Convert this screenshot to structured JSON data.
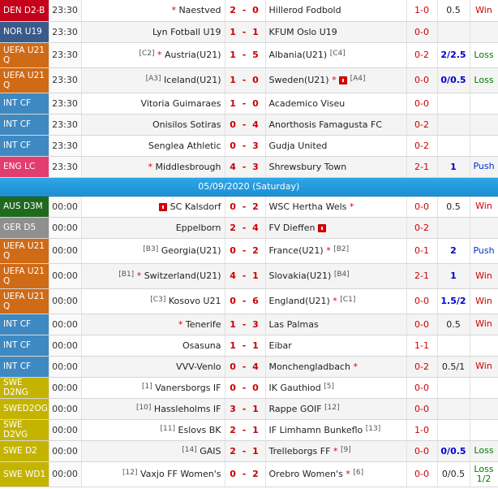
{
  "colors": {
    "DEN D2-B": "#c5001a",
    "NOR U19": "#3a5a8a",
    "UEFA U21 Q": "#cf6a16",
    "INT CF": "#3f89c2",
    "ENG LC": "#e23d72",
    "AUS D3M": "#1f6a1f",
    "GER D5": "#8f8f8f",
    "SWE D2NG": "#c4b400",
    "SWED2OG": "#c4b400",
    "SWE D2VG": "#c4b400",
    "SWE D2": "#c4b400",
    "SWE WD1": "#c4b400"
  },
  "date_header": "05/09/2020 (Saturday)",
  "matches_before": [
    {
      "league": "DEN D2-B",
      "time": "23:30",
      "home_rank": "",
      "home_star": true,
      "home_card": false,
      "home": "Naestved",
      "score": "2 - 0",
      "away": "Hillerod Fodbold",
      "away_star": false,
      "away_card": false,
      "away_rank": "",
      "ht": "1-0",
      "hc": "0.5",
      "hc_blue": false,
      "result": "Win",
      "result_type": "win",
      "size": "r1"
    },
    {
      "league": "NOR U19",
      "time": "23:30",
      "home_rank": "",
      "home_star": false,
      "home_card": false,
      "home": "Lyn Fotball U19",
      "score": "1 - 1",
      "away": "KFUM Oslo U19",
      "away_star": false,
      "away_card": false,
      "away_rank": "",
      "ht": "0-0",
      "hc": "",
      "hc_blue": false,
      "result": "",
      "result_type": "",
      "size": "r1"
    },
    {
      "league": "UEFA U21 Q",
      "time": "23:30",
      "home_rank": "[C2]",
      "home_star": true,
      "home_card": false,
      "home": "Austria(U21)",
      "score": "1 - 5",
      "away": "Albania(U21)",
      "away_star": false,
      "away_card": false,
      "away_rank": "[C4]",
      "ht": "0-2",
      "hc": "2/2.5",
      "hc_blue": true,
      "result": "Loss",
      "result_type": "loss",
      "size": "r2"
    },
    {
      "league": "UEFA U21 Q",
      "time": "23:30",
      "home_rank": "[A3]",
      "home_star": false,
      "home_card": false,
      "home": "Iceland(U21)",
      "score": "1 - 0",
      "away": "Sweden(U21)",
      "away_star": true,
      "away_card": true,
      "away_rank": "[A4]",
      "ht": "0-0",
      "hc": "0/0.5",
      "hc_blue": true,
      "result": "Loss",
      "result_type": "loss",
      "size": "r2"
    },
    {
      "league": "INT CF",
      "time": "23:30",
      "home_rank": "",
      "home_star": false,
      "home_card": false,
      "home": "Vitoria Guimaraes",
      "score": "1 - 0",
      "away": "Academico Viseu",
      "away_star": false,
      "away_card": false,
      "away_rank": "",
      "ht": "0-0",
      "hc": "",
      "hc_blue": false,
      "result": "",
      "result_type": "",
      "size": "r1"
    },
    {
      "league": "INT CF",
      "time": "23:30",
      "home_rank": "",
      "home_star": false,
      "home_card": false,
      "home": "Onisilos Sotiras",
      "score": "0 - 4",
      "away": "Anorthosis Famagusta FC",
      "away_star": false,
      "away_card": false,
      "away_rank": "",
      "ht": "0-2",
      "hc": "",
      "hc_blue": false,
      "result": "",
      "result_type": "",
      "size": "r1"
    },
    {
      "league": "INT CF",
      "time": "23:30",
      "home_rank": "",
      "home_star": false,
      "home_card": false,
      "home": "Senglea Athletic",
      "score": "0 - 3",
      "away": "Gudja United",
      "away_star": false,
      "away_card": false,
      "away_rank": "",
      "ht": "0-2",
      "hc": "",
      "hc_blue": false,
      "result": "",
      "result_type": "",
      "size": "r1"
    },
    {
      "league": "ENG LC",
      "time": "23:30",
      "home_rank": "",
      "home_star": true,
      "home_card": false,
      "home": "Middlesbrough",
      "score": "4 - 3",
      "away": "Shrewsbury Town",
      "away_star": false,
      "away_card": false,
      "away_rank": "",
      "ht": "2-1",
      "hc": "1",
      "hc_blue": true,
      "result": "Push",
      "result_type": "push",
      "size": "r1"
    }
  ],
  "matches_after": [
    {
      "league": "AUS D3M",
      "time": "00:00",
      "home_rank": "",
      "home_star": false,
      "home_card": true,
      "home": "SC Kalsdorf",
      "score": "0 - 2",
      "away": "WSC Hertha Wels",
      "away_star": true,
      "away_card": false,
      "away_rank": "",
      "ht": "0-0",
      "hc": "0.5",
      "hc_blue": false,
      "result": "Win",
      "result_type": "win",
      "size": "r1"
    },
    {
      "league": "GER D5",
      "time": "00:00",
      "home_rank": "",
      "home_star": false,
      "home_card": false,
      "home": "Eppelborn",
      "score": "2 - 4",
      "away": "FV Dieffen",
      "away_star": false,
      "away_card": true,
      "away_rank": "",
      "ht": "0-2",
      "hc": "",
      "hc_blue": false,
      "result": "",
      "result_type": "",
      "size": "r1"
    },
    {
      "league": "UEFA U21 Q",
      "time": "00:00",
      "home_rank": "[B3]",
      "home_star": false,
      "home_card": false,
      "home": "Georgia(U21)",
      "score": "0 - 2",
      "away": "France(U21)",
      "away_star": true,
      "away_card": false,
      "away_rank": "[B2]",
      "ht": "0-1",
      "hc": "2",
      "hc_blue": true,
      "result": "Push",
      "result_type": "push",
      "size": "r2"
    },
    {
      "league": "UEFA U21 Q",
      "time": "00:00",
      "home_rank": "[B1]",
      "home_star": true,
      "home_card": false,
      "home": "Switzerland(U21)",
      "score": "4 - 1",
      "away": "Slovakia(U21)",
      "away_star": false,
      "away_card": false,
      "away_rank": "[B4]",
      "ht": "2-1",
      "hc": "1",
      "hc_blue": true,
      "result": "Win",
      "result_type": "win",
      "size": "r2"
    },
    {
      "league": "UEFA U21 Q",
      "time": "00:00",
      "home_rank": "[C3]",
      "home_star": false,
      "home_card": false,
      "home": "Kosovo U21",
      "score": "0 - 6",
      "away": "England(U21)",
      "away_star": true,
      "away_card": false,
      "away_rank": "[C1]",
      "ht": "0-0",
      "hc": "1.5/2",
      "hc_blue": true,
      "result": "Win",
      "result_type": "win",
      "size": "r2"
    },
    {
      "league": "INT CF",
      "time": "00:00",
      "home_rank": "",
      "home_star": true,
      "home_card": false,
      "home": "Tenerife",
      "score": "1 - 3",
      "away": "Las Palmas",
      "away_star": false,
      "away_card": false,
      "away_rank": "",
      "ht": "0-0",
      "hc": "0.5",
      "hc_blue": false,
      "result": "Win",
      "result_type": "win",
      "size": "r1"
    },
    {
      "league": "INT CF",
      "time": "00:00",
      "home_rank": "",
      "home_star": false,
      "home_card": false,
      "home": "Osasuna",
      "score": "1 - 1",
      "away": "Eibar",
      "away_star": false,
      "away_card": false,
      "away_rank": "",
      "ht": "1-1",
      "hc": "",
      "hc_blue": false,
      "result": "",
      "result_type": "",
      "size": "r1"
    },
    {
      "league": "INT CF",
      "time": "00:00",
      "home_rank": "",
      "home_star": false,
      "home_card": false,
      "home": "VVV-Venlo",
      "score": "0 - 4",
      "away": "Monchengladbach",
      "away_star": true,
      "away_card": false,
      "away_rank": "",
      "ht": "0-2",
      "hc": "0.5/1",
      "hc_blue": false,
      "result": "Win",
      "result_type": "win",
      "size": "r1"
    },
    {
      "league": "SWE D2NG",
      "time": "00:00",
      "home_rank": "[1]",
      "home_star": false,
      "home_card": false,
      "home": "Vanersborgs IF",
      "score": "0 - 0",
      "away": "IK Gauthiod",
      "away_star": false,
      "away_card": false,
      "away_rank": "[5]",
      "ht": "0-0",
      "hc": "",
      "hc_blue": false,
      "result": "",
      "result_type": "",
      "size": "r1"
    },
    {
      "league": "SWED2OG",
      "time": "00:00",
      "home_rank": "[10]",
      "home_star": false,
      "home_card": false,
      "home": "Hassleholms IF",
      "score": "3 - 1",
      "away": "Rappe GOIF",
      "away_star": false,
      "away_card": false,
      "away_rank": "[12]",
      "ht": "0-0",
      "hc": "",
      "hc_blue": false,
      "result": "",
      "result_type": "",
      "size": "r1"
    },
    {
      "league": "SWE D2VG",
      "time": "00:00",
      "home_rank": "[11]",
      "home_star": false,
      "home_card": false,
      "home": "Eslovs BK",
      "score": "2 - 1",
      "away": "IF Limhamn Bunkeflo",
      "away_star": false,
      "away_card": false,
      "away_rank": "[13]",
      "ht": "1-0",
      "hc": "",
      "hc_blue": false,
      "result": "",
      "result_type": "",
      "size": "r1"
    },
    {
      "league": "SWE D2",
      "time": "00:00",
      "home_rank": "[14]",
      "home_star": false,
      "home_card": false,
      "home": "GAIS",
      "score": "2 - 1",
      "away": "Trelleborgs FF",
      "away_star": true,
      "away_card": false,
      "away_rank": "[9]",
      "ht": "0-0",
      "hc": "0/0.5",
      "hc_blue": true,
      "result": "Loss",
      "result_type": "loss",
      "size": "r1"
    },
    {
      "league": "SWE WD1",
      "time": "00:00",
      "home_rank": "[12]",
      "home_star": false,
      "home_card": false,
      "home": "Vaxjo FF Women's",
      "score": "0 - 2",
      "away": "Orebro Women's",
      "away_star": true,
      "away_card": false,
      "away_rank": "[6]",
      "ht": "0-0",
      "hc": "0/0.5",
      "hc_blue": false,
      "result": "Loss 1/2",
      "result_type": "loss",
      "size": "r2"
    }
  ]
}
